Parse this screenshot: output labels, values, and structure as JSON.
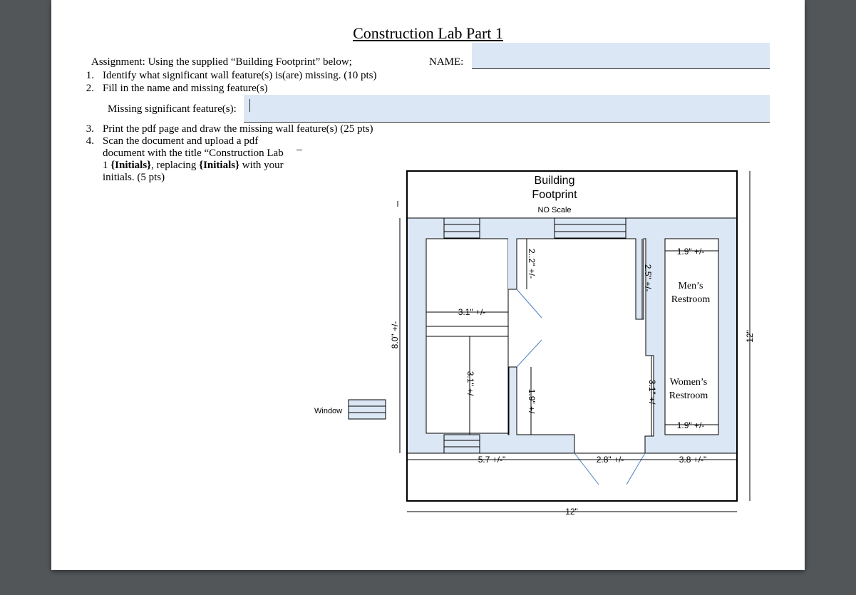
{
  "doc": {
    "title": "Construction Lab Part 1",
    "assignment": "Assignment:  Using the supplied “Building Footprint” below;",
    "name_label": "NAME:",
    "items": [
      {
        "num": "1.",
        "text": "Identify what significant wall feature(s) is(are) missing. (10 pts)"
      },
      {
        "num": "2.",
        "text": "Fill in the name and missing feature(s)"
      },
      {
        "num": "3.",
        "text": "Print the pdf page and draw the missing wall feature(s) (25 pts)"
      },
      {
        "num": "4.",
        "line1": "Scan the document and upload a pdf",
        "line2": "document with the title “Construction Lab",
        "line3_a": "1 ",
        "line3_b": "{Initials}",
        "line3_c": ", replacing ",
        "line3_d": "{Initials}",
        "line3_e": " with your",
        "line4": "initials. (5 pts)"
      }
    ],
    "missing_label": "Missing significant feature(s):",
    "name_value": "",
    "missing_value": ""
  },
  "drawing": {
    "title_line1": "Building",
    "title_line2": "Footprint",
    "scale": "NO Scale",
    "window_label": "Window",
    "rooms": {
      "mens_line1": "Men’s",
      "mens_line2": "Restroom",
      "womens_line1": "Women’s",
      "womens_line2": "Restroom"
    },
    "dims": {
      "d_3_1_horiz": "3.1\" +/-",
      "d_2_2": "2..2\" +/-",
      "d_2_5": "2.5\" +/-",
      "d_1_9_top": "1.9\" +/-",
      "d_8_0": "8.0\" +/-",
      "d_3_1_vert": "3.1\" +/-",
      "d_1_9_vert": "1.9\" +/-",
      "d_3_1_right": "3.1\" +/-",
      "d_1_9_bottom": "1.9\" +/-",
      "d_5_7": "5.7 +/-\"",
      "d_2_8": "2.8\" +/-",
      "d_3_8": "3.8 +/-\"",
      "d_12_h": "12\"",
      "d_12_v": "12\""
    },
    "colors": {
      "floor": "#dce7f5",
      "line": "#000000",
      "door": "#4a7fc1"
    }
  }
}
